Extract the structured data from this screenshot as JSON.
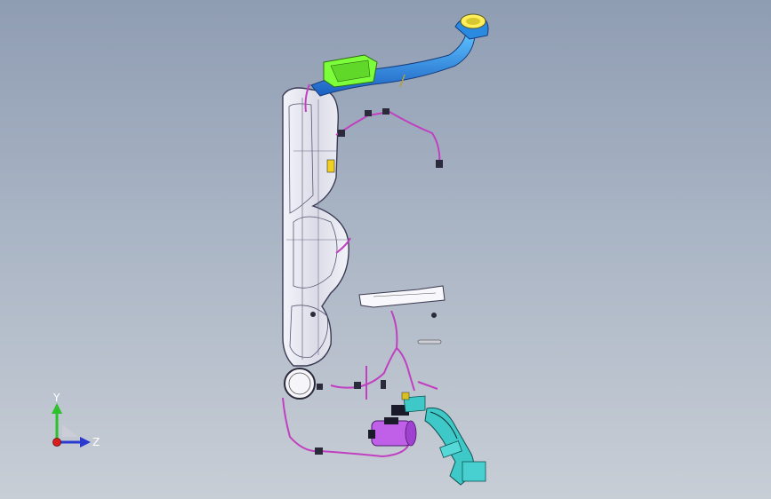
{
  "viewport": {
    "background_top": "#8f9db3",
    "background_bottom": "#c8ced6"
  },
  "model": {
    "parts": [
      {
        "name": "fuel-tank",
        "color": "#e8e8f0"
      },
      {
        "name": "filler-neck",
        "color": "#1f7fd8"
      },
      {
        "name": "filler-cap-ring",
        "color": "#ffef5a"
      },
      {
        "name": "canister-bracket",
        "color": "#7cff3a"
      },
      {
        "name": "vapor-lines",
        "color": "#c040c0"
      },
      {
        "name": "evap-canister",
        "color": "#c060e8"
      },
      {
        "name": "pump-assembly",
        "color": "#3ec8c8"
      }
    ]
  },
  "triad": {
    "y_label": "Y",
    "z_label": "Z",
    "y_color": "#2ec02e",
    "z_color": "#2a3ad0",
    "x_color": "#d81e1e"
  }
}
